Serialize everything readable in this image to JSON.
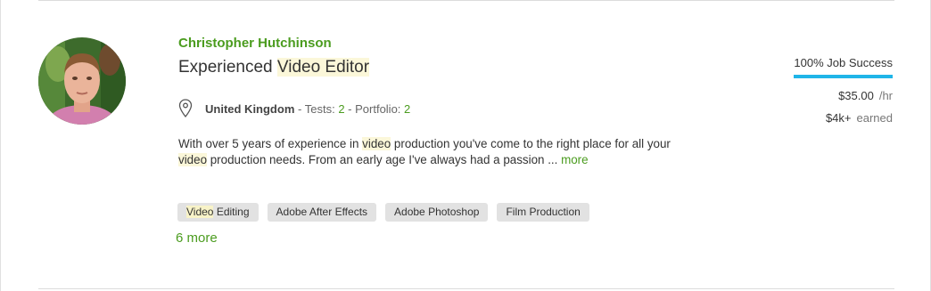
{
  "freelancer": {
    "name": "Christopher Hutchinson",
    "title_prefix": "Experienced ",
    "title_highlight": "Video Editor",
    "location": {
      "icon": "map-pin-icon",
      "country": "United Kingdom",
      "tests_label": "- Tests:",
      "tests_count": "2",
      "portfolio_label": "- Portfolio:",
      "portfolio_count": "2"
    },
    "description": {
      "part1": "With over 5 years of experience in ",
      "hl1": "video",
      "part2": " production you've come to the right place for all your ",
      "hl2": "video",
      "part3": " production needs. From an early age I've always had a passion ... ",
      "more_label": "more"
    },
    "skills": [
      {
        "highlight": "Video",
        "rest": " Editing"
      },
      {
        "highlight": "",
        "rest": "Adobe After Effects"
      },
      {
        "highlight": "",
        "rest": "Adobe Photoshop"
      },
      {
        "highlight": "",
        "rest": "Film Production"
      }
    ],
    "more_skills_label": "6 more",
    "stats": {
      "job_success": "100% Job Success",
      "rate": "$35.00",
      "rate_unit": "/hr",
      "earned": "$4k+",
      "earned_unit": "earned"
    }
  },
  "colors": {
    "green": "#4b9c1f",
    "job_success_bar": "#1fb5e8",
    "highlight": "#fbf7d9",
    "skill_bg": "#e2e2e2"
  }
}
